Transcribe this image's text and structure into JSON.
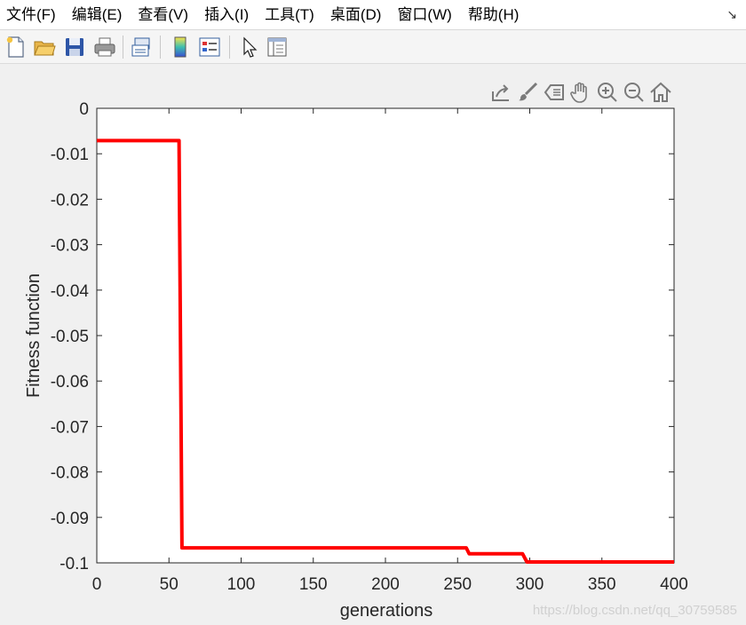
{
  "menubar": {
    "items": [
      "文件(F)",
      "编辑(E)",
      "查看(V)",
      "插入(I)",
      "工具(T)",
      "桌面(D)",
      "窗口(W)",
      "帮助(H)"
    ],
    "corner_arrow": "↘"
  },
  "toolbar": {
    "icons": [
      "new-file-icon",
      "open-folder-icon",
      "save-icon",
      "print-icon",
      "link-figure-icon",
      "insert-colorbar-icon",
      "insert-legend-icon",
      "pointer-icon",
      "property-inspector-icon"
    ]
  },
  "axes_toolbar": {
    "icons": [
      "export-icon",
      "brush-icon",
      "data-tips-icon",
      "pan-hand-icon",
      "zoom-in-icon",
      "zoom-out-icon",
      "home-icon"
    ]
  },
  "chart_data": {
    "type": "line",
    "xlabel": "generations",
    "ylabel": "Fitness function",
    "xlim": [
      0,
      400
    ],
    "ylim": [
      -0.1,
      0
    ],
    "xticks": [
      0,
      50,
      100,
      150,
      200,
      250,
      300,
      350,
      400
    ],
    "xtick_labels": [
      "0",
      "50",
      "100",
      "150",
      "200",
      "250",
      "300",
      "350",
      "400"
    ],
    "yticks": [
      0,
      -0.01,
      -0.02,
      -0.03,
      -0.04,
      -0.05,
      -0.06,
      -0.07,
      -0.08,
      -0.09,
      -0.1
    ],
    "ytick_labels": [
      "0",
      "-0.01",
      "-0.02",
      "-0.03",
      "-0.04",
      "-0.05",
      "-0.06",
      "-0.07",
      "-0.08",
      "-0.09",
      "-0.1"
    ],
    "grid": false,
    "series": [
      {
        "color": "#ff0000",
        "x": [
          0,
          57,
          59,
          256,
          258,
          295,
          298,
          400
        ],
        "y": [
          -0.0071,
          -0.0071,
          -0.0967,
          -0.0967,
          -0.098,
          -0.098,
          -0.0998,
          -0.0998
        ]
      }
    ]
  },
  "watermark": "https://blog.csdn.net/qq_30759585"
}
